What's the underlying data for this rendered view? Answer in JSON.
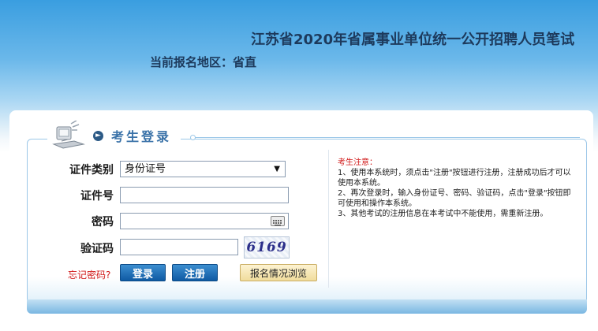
{
  "header": {
    "title": "江苏省2020年省属事业单位统一公开招聘人员笔试",
    "region": "当前报名地区：省直"
  },
  "login": {
    "title": "考生登录",
    "id_type_label": "证件类别",
    "id_type_value": "身份证号",
    "id_number_label": "证件号",
    "id_number_value": "",
    "password_label": "密码",
    "password_value": "",
    "captcha_label": "验证码",
    "captcha_input_value": "",
    "captcha_text": "6169",
    "forgot_password": "忘记密码?",
    "login_button": "登录",
    "register_button": "注册",
    "browse_button": "报名情况浏览"
  },
  "notice": {
    "title": "考生注意：",
    "items": [
      "1、使用本系统时，须点击\"注册\"按钮进行注册，注册成功后才可以使用本系统。",
      "2、再次登录时，输入身份证号、密码、验证码，点击\"登录\"按钮即可使用和操作本系统。",
      "3、其他考试的注册信息在本考试中不能使用，需重新注册。"
    ]
  },
  "colors": {
    "accent_blue": "#0f5aa3",
    "title_blue": "#3a72a8",
    "notice_red": "#d11a1a"
  },
  "icons": {
    "computer": "computer-icon",
    "bullet": "circle-arrow-icon",
    "keyboard": "keyboard-icon",
    "dropdown": "chevron-down-icon"
  }
}
